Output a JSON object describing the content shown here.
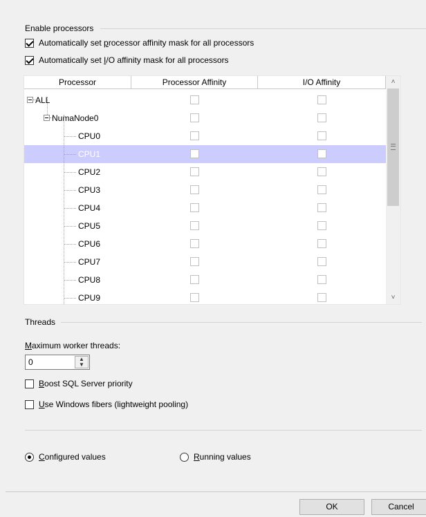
{
  "enable_processors": {
    "group_label": "Enable processors",
    "auto_processor_affinity": {
      "prefix": "Automatically set ",
      "accel": "p",
      "suffix": "rocessor affinity mask for all processors",
      "checked": true
    },
    "auto_io_affinity": {
      "prefix": "Automatically set ",
      "accel": "I",
      "suffix": "/O affinity mask for all processors",
      "checked": true
    }
  },
  "grid": {
    "columns": [
      "Processor",
      "Processor Affinity",
      "I/O Affinity"
    ],
    "rows": [
      {
        "label": "ALL",
        "level": 0,
        "expander": true,
        "selected": false
      },
      {
        "label": "NumaNode0",
        "level": 1,
        "expander": true,
        "selected": false
      },
      {
        "label": "CPU0",
        "level": 2,
        "selected": false
      },
      {
        "label": "CPU1",
        "level": 2,
        "selected": true
      },
      {
        "label": "CPU2",
        "level": 2,
        "selected": false
      },
      {
        "label": "CPU3",
        "level": 2,
        "selected": false
      },
      {
        "label": "CPU4",
        "level": 2,
        "selected": false
      },
      {
        "label": "CPU5",
        "level": 2,
        "selected": false
      },
      {
        "label": "CPU6",
        "level": 2,
        "selected": false
      },
      {
        "label": "CPU7",
        "level": 2,
        "selected": false
      },
      {
        "label": "CPU8",
        "level": 2,
        "selected": false
      },
      {
        "label": "CPU9",
        "level": 2,
        "selected": false
      }
    ],
    "scroll_up": "˄",
    "scroll_down": "˅"
  },
  "threads": {
    "group_label": "Threads",
    "max_worker": {
      "accel": "M",
      "rest": "aximum worker threads:"
    },
    "max_worker_value": "0",
    "boost": {
      "accel": "B",
      "rest": "oost SQL Server priority",
      "checked": false
    },
    "fibers": {
      "accel": "U",
      "rest": "se Windows fibers (lightweight pooling)",
      "checked": false
    }
  },
  "values_mode": {
    "configured": {
      "accel": "C",
      "rest": "onfigured  values",
      "selected": true
    },
    "running": {
      "accel": "R",
      "rest": "unning values",
      "selected": false
    }
  },
  "buttons": {
    "ok": "OK",
    "cancel": "Cancel"
  }
}
